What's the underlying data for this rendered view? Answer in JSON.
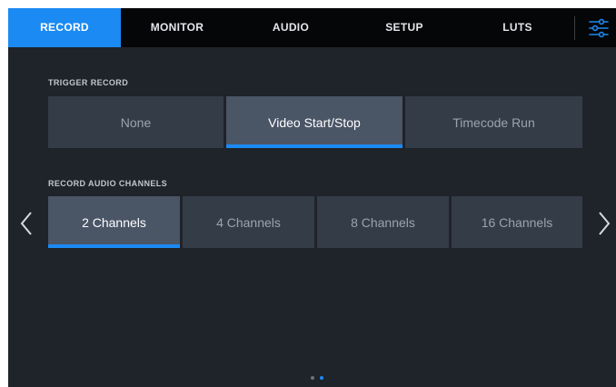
{
  "tabs": [
    {
      "label": "RECORD",
      "active": true
    },
    {
      "label": "MONITOR",
      "active": false
    },
    {
      "label": "AUDIO",
      "active": false
    },
    {
      "label": "SETUP",
      "active": false
    },
    {
      "label": "LUTS",
      "active": false
    }
  ],
  "trigger_record": {
    "label": "TRIGGER RECORD",
    "options": [
      "None",
      "Video Start/Stop",
      "Timecode Run"
    ],
    "selected": "Video Start/Stop"
  },
  "record_audio_channels": {
    "label": "RECORD AUDIO CHANNELS",
    "options": [
      "2 Channels",
      "4 Channels",
      "8 Channels",
      "16 Channels"
    ],
    "selected": "2 Channels"
  },
  "pagination": {
    "pages": 2,
    "current": 2
  },
  "icons": {
    "settings": "sliders-icon",
    "prev": "chevron-left-icon",
    "next": "chevron-right-icon"
  },
  "colors": {
    "accent": "#1b8af3",
    "background": "#1f232a",
    "tabbar": "#050607",
    "segment": "#343c48",
    "segment_selected": "#4a5566"
  }
}
